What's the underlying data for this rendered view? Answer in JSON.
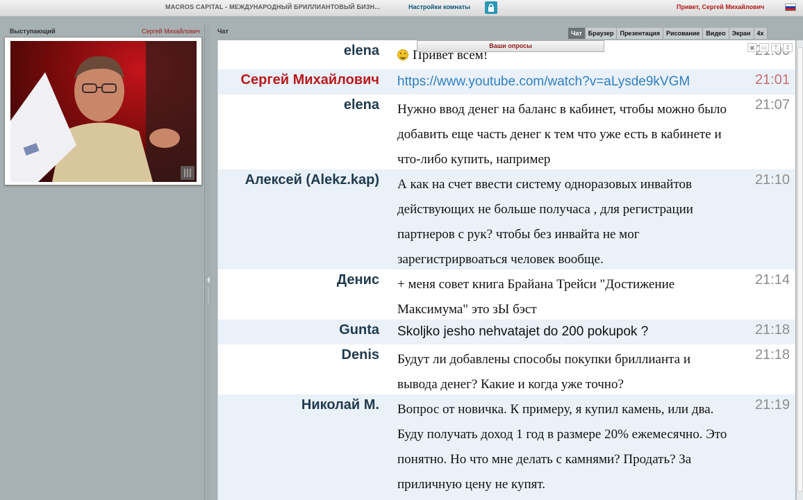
{
  "topbar": {
    "room_title": "MACROS CAPITAL - МЕЖДУНАРОДНЫЙ БРИЛЛИАНТОВЫЙ БИЗН...",
    "room_settings": "Настройки комнаты",
    "lock_icon": "lock-icon",
    "greeting": "Привет, Сергей Михайлович",
    "flag_icon": "russian-flag-icon",
    "flag_colors": [
      "#ffffff",
      "#1c3fa8",
      "#d21e1e"
    ]
  },
  "left_panel": {
    "speaker_label": "Выступающий",
    "speaker_name": "Сергей Михайлович"
  },
  "chat": {
    "title": "Чат",
    "polls_label": "Ваши опросы",
    "tabs": [
      "Чат",
      "Браузер",
      "Презентация",
      "Рисование",
      "Видео",
      "Экран",
      "4x"
    ],
    "active_tab": "Чат",
    "tools": [
      "image-icon",
      "text-smaller-icon",
      "text-larger-icon",
      "font-size-icon"
    ],
    "messages": [
      {
        "author": "elena",
        "text": "Привет всем!",
        "time": "21:00",
        "emoji": "smile-icon",
        "lines": 1
      },
      {
        "author": "Сергей Михайлович",
        "text": "https://www.youtube.com/watch?v=aLysde9kVGM",
        "time": "21:01",
        "is_host": true,
        "is_link": true,
        "lines": 1
      },
      {
        "author": "elena",
        "text": "Нужно ввод денег на баланс в кабинет, чтобы можно было добавить еще часть денег к тем что уже есть в кабинете и что-либо купить, например",
        "time": "21:07",
        "lines": 3
      },
      {
        "author": "Алексей (Alekz.kap)",
        "text": "А как на счет ввести систему одноразовых инвайтов действующих не больше получаса , для регистрации партнеров с рук? чтобы без инвайта не мог зарегистрирвоаться человек вообще.",
        "time": "21:10",
        "lines": 4
      },
      {
        "author": "Денис",
        "text": "+ меня совет книга Брайана Трейси \"Достижение Максимума\" это зЫ бэст",
        "time": "21:14",
        "lines": 2
      },
      {
        "author": "Gunta",
        "text": "Skoljko jesho nehvatajet do 200 pokupok ?",
        "time": "21:18",
        "lines": 1
      },
      {
        "author": "Denis",
        "text": "Будут ли добавлены способы покупки бриллианта и вывода денег? Какие и когда уже точно?",
        "time": "21:18",
        "lines": 2
      },
      {
        "author": "Николай М.",
        "text": "Вопрос от новичка. К примеру, я купил камень, или два. Буду получать доход 1 год в размере 20% ежемесячно. Это понятно. Но что мне делать с камнями? Продать? За приличную цену не купят.",
        "time": "21:19",
        "lines": 4
      }
    ]
  },
  "colors": {
    "host_name": "#b81a1a",
    "link": "#2f7fc1",
    "row_alt": "#eaf1f9",
    "accent": "#2a97b5"
  }
}
